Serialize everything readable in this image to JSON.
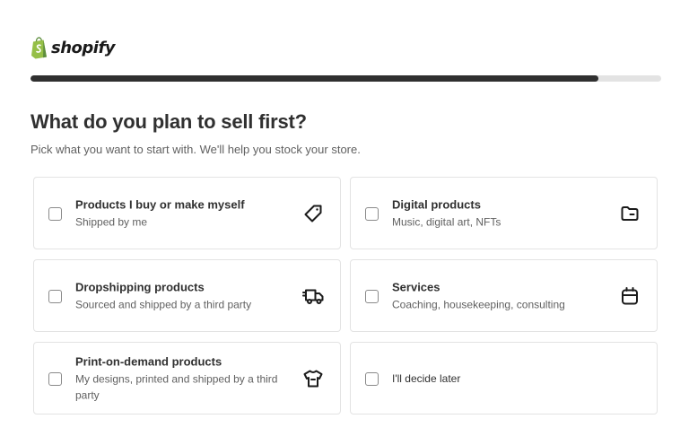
{
  "brand": {
    "name": "shopify"
  },
  "progress": {
    "fraction": 0.9
  },
  "heading": "What do you plan to sell first?",
  "subheading": "Pick what you want to start with. We'll help you stock your store.",
  "options": [
    {
      "title": "Products I buy or make myself",
      "subtitle": "Shipped by me",
      "icon": "tag-icon"
    },
    {
      "title": "Digital products",
      "subtitle": "Music, digital art, NFTs",
      "icon": "folder-icon"
    },
    {
      "title": "Dropshipping products",
      "subtitle": "Sourced and shipped by a third party",
      "icon": "truck-icon"
    },
    {
      "title": "Services",
      "subtitle": "Coaching, housekeeping, consulting",
      "icon": "calendar-icon"
    },
    {
      "title": "Print-on-demand products",
      "subtitle": "My designs, printed and shipped by a third party",
      "icon": "tshirt-icon"
    },
    {
      "label": "I'll decide later"
    }
  ],
  "colors": {
    "brand_green": "#95bf47",
    "brand_green_dark": "#5e8e3e",
    "progress_fill": "#303030",
    "progress_track": "#e3e3e3"
  }
}
